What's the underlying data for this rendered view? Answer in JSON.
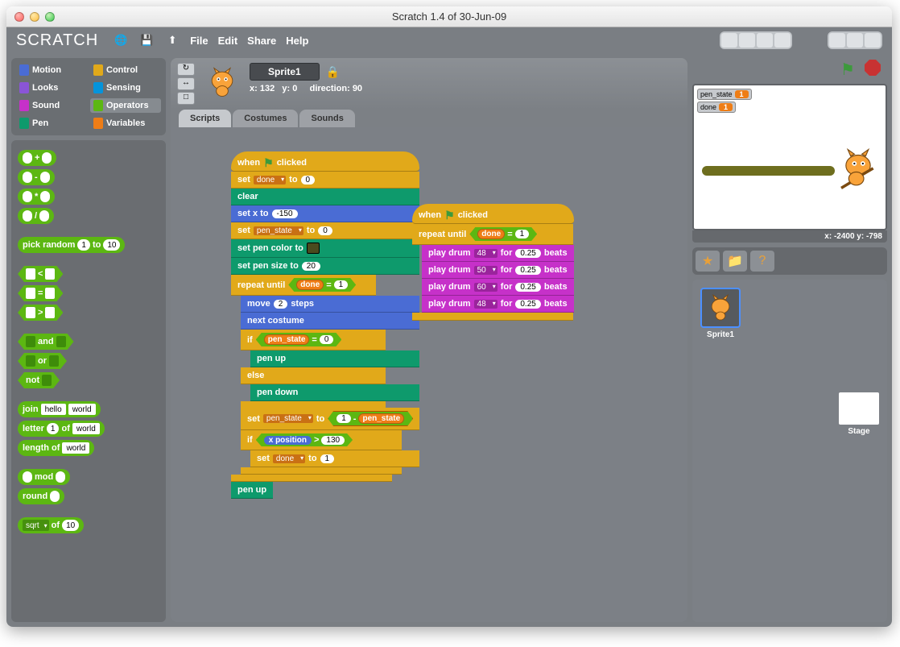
{
  "window": {
    "title": "Scratch 1.4 of 30-Jun-09"
  },
  "menu": {
    "file": "File",
    "edit": "Edit",
    "share": "Share",
    "help": "Help",
    "logo": "SCRATCH"
  },
  "categories": [
    {
      "name": "Motion",
      "color": "#4a6cd4"
    },
    {
      "name": "Control",
      "color": "#e1a91a"
    },
    {
      "name": "Looks",
      "color": "#8a55d7"
    },
    {
      "name": "Sensing",
      "color": "#0494dc"
    },
    {
      "name": "Sound",
      "color": "#c631c9"
    },
    {
      "name": "Operators",
      "color": "#5cb712",
      "sel": true
    },
    {
      "name": "Pen",
      "color": "#0e9a6c"
    },
    {
      "name": "Variables",
      "color": "#ee7d16"
    }
  ],
  "operators": {
    "random_label": "pick random",
    "to": "to",
    "one": "1",
    "ten": "10",
    "and": "and",
    "or": "or",
    "not": "not",
    "join": "join",
    "hello": "hello",
    "world": "world",
    "letter": "letter",
    "of": "of",
    "length": "length of",
    "mod": "mod",
    "round": "round",
    "sqrt": "sqrt"
  },
  "sprite": {
    "name": "Sprite1",
    "x_label": "x:",
    "x": "132",
    "y_label": "y:",
    "y": "0",
    "dir_label": "direction:",
    "dir": "90"
  },
  "tabs": {
    "scripts": "Scripts",
    "costumes": "Costumes",
    "sounds": "Sounds"
  },
  "script1": {
    "hat": "when",
    "hat2": "clicked",
    "set": "set",
    "to": "to",
    "done": "done",
    "zero": "0",
    "clear": "clear",
    "setx": "set x to",
    "neg150": "-150",
    "pen_state": "pen_state",
    "pen_color": "set pen color to",
    "pen_size": "set pen size to",
    "twenty": "20",
    "repeat": "repeat until",
    "eq": "=",
    "one": "1",
    "move": "move",
    "two": "2",
    "steps": "steps",
    "next": "next costume",
    "if": "if",
    "else": "else",
    "penup": "pen up",
    "pendown": "pen down",
    "minus": "-",
    "xpos": "x position",
    "gt": ">",
    "v130": "130"
  },
  "script2": {
    "hat": "when",
    "hat2": "clicked",
    "repeat": "repeat until",
    "done": "done",
    "eq": "=",
    "one": "1",
    "play": "play drum",
    "for": "for",
    "beats": "beats",
    "d1": "48",
    "d2": "50",
    "d3": "60",
    "d4": "48",
    "dur": "0.25"
  },
  "stage": {
    "mon1": "pen_state",
    "mon1v": "1",
    "mon2": "done",
    "mon2v": "1",
    "coords": "x: -2400 y: -798",
    "label": "Stage",
    "sprite": "Sprite1"
  }
}
